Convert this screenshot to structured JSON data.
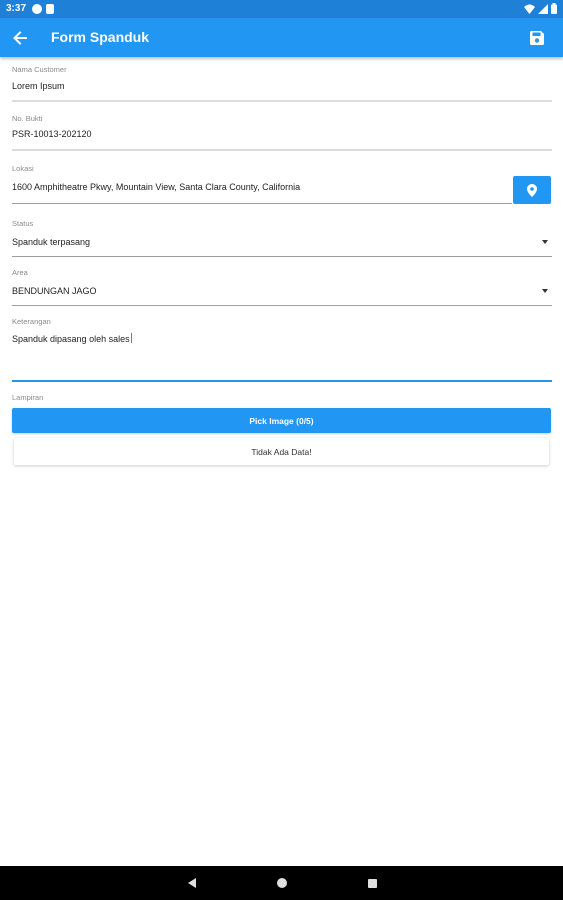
{
  "status_bar": {
    "time": "3:37",
    "left_icons": [
      "notification-icon",
      "sim-card-icon"
    ],
    "right_icons": [
      "wifi-icon",
      "signal-icon",
      "battery-icon"
    ]
  },
  "app_bar": {
    "title": "Form Spanduk",
    "back_icon": "arrow-left-icon",
    "save_icon": "save-icon"
  },
  "form": {
    "nama_customer": {
      "label": "Nama Customer",
      "value": "Lorem Ipsum"
    },
    "no_bukti": {
      "label": "No. Bukti",
      "value": "PSR-10013-202120"
    },
    "lokasi": {
      "label": "Lokasi",
      "value": "1600 Amphitheatre Pkwy, Mountain View, Santa Clara County, California",
      "button_icon": "map-pin-icon"
    },
    "status": {
      "label": "Status",
      "value": "Spanduk terpasang"
    },
    "area": {
      "label": "Area",
      "value": "BENDUNGAN JAGO"
    },
    "keterangan": {
      "label": "Keterangan",
      "value": "Spanduk dipasang oleh sales"
    },
    "lampiran": {
      "label": "Lampiran",
      "pick_button": "Pick Image (0/5)",
      "empty_text": "Tidak Ada Data!"
    }
  },
  "colors": {
    "status_bar": "#1e80d6",
    "app_bar": "#2196f3",
    "accent": "#2196f3",
    "nav_bar": "#000000"
  },
  "nav_bar": {
    "icons": [
      "back-icon",
      "home-icon",
      "recents-icon"
    ]
  }
}
